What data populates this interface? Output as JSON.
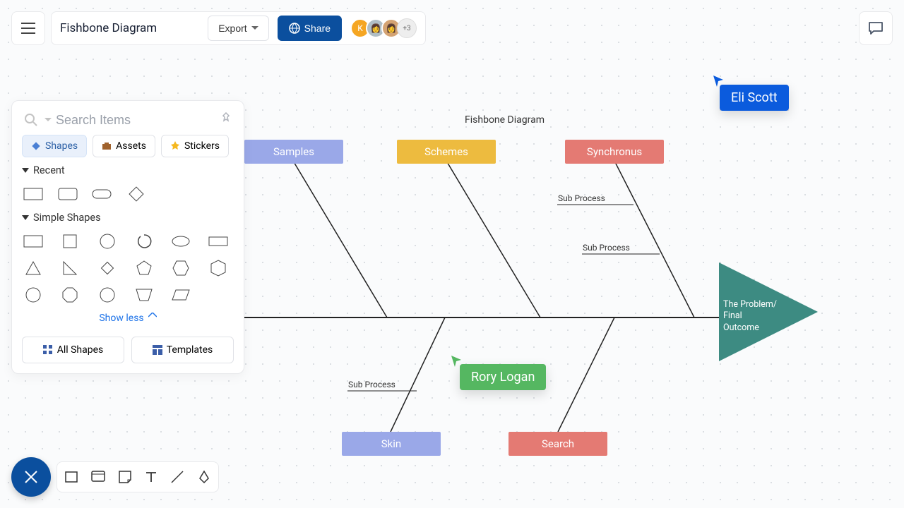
{
  "header": {
    "title": "Fishbone Diagram",
    "export_label": "Export",
    "share_label": "Share",
    "avatars": {
      "initial": "K",
      "more": "+3"
    }
  },
  "search": {
    "placeholder": "Search Items"
  },
  "tabs": {
    "shapes": "Shapes",
    "assets": "Assets",
    "stickers": "Stickers"
  },
  "sections": {
    "recent": "Recent",
    "simple": "Simple Shapes",
    "show_less": "Show less"
  },
  "bottom": {
    "all_shapes": "All Shapes",
    "templates": "Templates"
  },
  "diagram": {
    "title": "Fishbone Diagram",
    "samples": "Samples",
    "schemes": "Schemes",
    "synchronus": "Synchronus",
    "skin": "Skin",
    "search": "Search",
    "sub1": "Sub Process",
    "sub2": "Sub Process",
    "sub3": "Sub Process",
    "effect": "The Problem/\nFinal Outcome"
  },
  "cursors": {
    "eli": "Eli Scott",
    "rory": "Rory Logan"
  }
}
